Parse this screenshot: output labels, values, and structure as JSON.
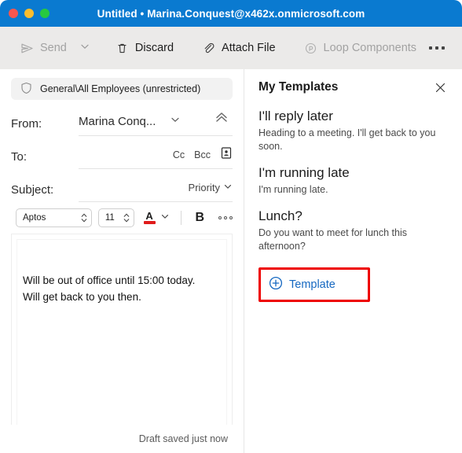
{
  "window": {
    "title": "Untitled • Marina.Conquest@x462x.onmicrosoft.com",
    "titlebar_color": "#0a7ad0",
    "traffic_lights": [
      "close",
      "minimize",
      "maximize"
    ]
  },
  "toolbar": {
    "send_label": "Send",
    "send_icon": "send-plane-icon",
    "send_chevron_icon": "chevron-down-icon",
    "discard_label": "Discard",
    "discard_icon": "trash-icon",
    "attach_label": "Attach File",
    "attach_icon": "paperclip-icon",
    "loop_label": "Loop Components",
    "loop_icon": "loop-icon",
    "overflow_icon": "ellipsis-icon"
  },
  "compose": {
    "sensitivity": {
      "icon": "shield-icon",
      "label": "General\\All Employees (unrestricted)"
    },
    "from": {
      "label": "From:",
      "value": "Marina Conq...",
      "dropdown_icon": "chevron-down-icon",
      "collapse_icon": "double-chevron-up-icon"
    },
    "to": {
      "label": "To:",
      "value": "",
      "cc_label": "Cc",
      "bcc_label": "Bcc",
      "address_book_icon": "address-book-icon"
    },
    "subject": {
      "label": "Subject:",
      "value": "",
      "priority_label": "Priority",
      "priority_icon": "chevron-down-icon"
    },
    "format": {
      "font_name": "Aptos",
      "font_size": "11",
      "font_color": "#e01b1b",
      "font_color_icon": "font-color-icon",
      "font_color_chevron_icon": "chevron-down-icon",
      "bold_label": "B",
      "more_icon": "more-formatting-icon",
      "stepper_icon": "stepper-icon"
    },
    "body_text": "Will be out of office until 15:00 today.\nWill get back to you then.",
    "status": "Draft saved just now"
  },
  "templates": {
    "title": "My Templates",
    "close_icon": "close-icon",
    "items": [
      {
        "name": "I'll reply later",
        "desc": "Heading to a meeting. I'll get back to you soon."
      },
      {
        "name": "I'm running late",
        "desc": "I'm running late."
      },
      {
        "name": "Lunch?",
        "desc": "Do you want to meet for lunch this afternoon?"
      }
    ],
    "add_label": "Template",
    "add_icon": "plus-circle-icon",
    "highlight_color": "#ee0000",
    "link_color": "#1668c1"
  }
}
